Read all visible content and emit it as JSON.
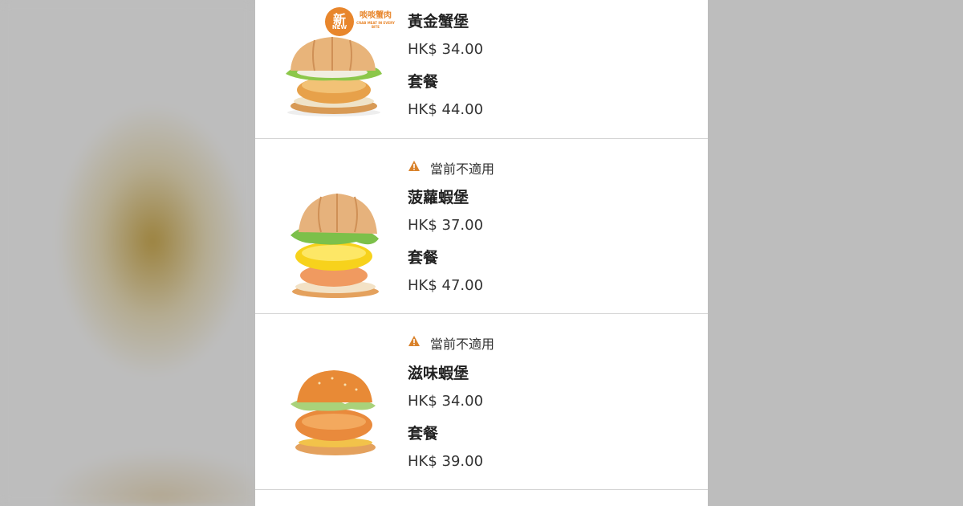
{
  "colors": {
    "warning": "#d9822b",
    "badge": "#e8862c"
  },
  "menu_items": [
    {
      "name": "黃金蟹堡",
      "price": "HK$ 34.00",
      "combo_label": "套餐",
      "combo_price": "HK$ 44.00",
      "warning": null,
      "badge": {
        "new_cn": "新",
        "new_en": "NEW",
        "promo_cn": "啖啖蟹肉",
        "promo_en": "CRAB MEAT IN EVERY BITE"
      }
    },
    {
      "name": "菠蘿蝦堡",
      "price": "HK$ 37.00",
      "combo_label": "套餐",
      "combo_price": "HK$ 47.00",
      "warning": "當前不適用"
    },
    {
      "name": "滋味蝦堡",
      "price": "HK$ 34.00",
      "combo_label": "套餐",
      "combo_price": "HK$ 39.00",
      "warning": "當前不適用"
    }
  ]
}
